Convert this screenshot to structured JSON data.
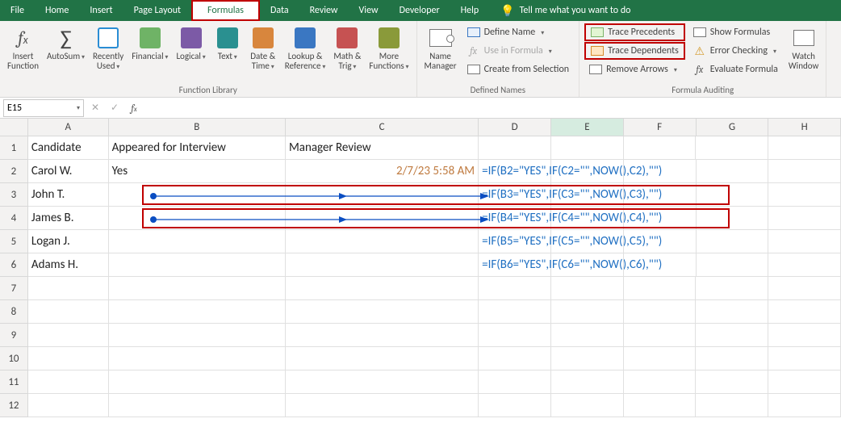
{
  "tabs": {
    "items": [
      "File",
      "Home",
      "Insert",
      "Page Layout",
      "Formulas",
      "Data",
      "Review",
      "View",
      "Developer",
      "Help"
    ],
    "active": "Formulas",
    "highlighted": "Formulas",
    "tell_me": "Tell me what you want to do"
  },
  "ribbon": {
    "groups": {
      "function_library": {
        "label": "Function Library",
        "insert_function": "Insert\nFunction",
        "autosum": "AutoSum",
        "recently_used": "Recently\nUsed",
        "financial": "Financial",
        "logical": "Logical",
        "text": "Text",
        "date_time": "Date &\nTime",
        "lookup_ref": "Lookup &\nReference",
        "math_trig": "Math &\nTrig",
        "more_functions": "More\nFunctions"
      },
      "defined_names": {
        "label": "Defined Names",
        "name_manager": "Name\nManager",
        "define_name": "Define Name",
        "use_in_formula": "Use in Formula",
        "create_from_selection": "Create from Selection"
      },
      "formula_auditing": {
        "label": "Formula Auditing",
        "trace_precedents": "Trace Precedents",
        "trace_dependents": "Trace Dependents",
        "remove_arrows": "Remove Arrows",
        "show_formulas": "Show Formulas",
        "error_checking": "Error Checking",
        "evaluate_formula": "Evaluate Formula",
        "watch_window": "Watch\nWindow"
      }
    }
  },
  "formula_bar": {
    "name_box": "E15",
    "formula": ""
  },
  "grid": {
    "columns": [
      "A",
      "B",
      "C",
      "D",
      "E",
      "F",
      "G",
      "H"
    ],
    "headers": {
      "A": "Candidate",
      "B": "Appeared for Interview",
      "C": "Manager Review"
    },
    "rows": [
      {
        "n": 2,
        "A": "Carol W.",
        "B": "Yes",
        "C": "2/7/23 5:58 AM",
        "D": "=IF(B2=\"YES\",IF(C2=\"\",NOW(),C2),\"\")"
      },
      {
        "n": 3,
        "A": "John T.",
        "B": "",
        "C": "",
        "D": "=IF(B3=\"YES\",IF(C3=\"\",NOW(),C3),\"\")"
      },
      {
        "n": 4,
        "A": "James B.",
        "B": "",
        "C": "",
        "D": "=IF(B4=\"YES\",IF(C4=\"\",NOW(),C4),\"\")"
      },
      {
        "n": 5,
        "A": "Logan J.",
        "B": "",
        "C": "",
        "D": "=IF(B5=\"YES\",IF(C5=\"\",NOW(),C5),\"\")"
      },
      {
        "n": 6,
        "A": "Adams H.",
        "B": "",
        "C": "",
        "D": "=IF(B6=\"YES\",IF(C6=\"\",NOW(),C6),\"\")"
      }
    ],
    "selected_cell": "E15",
    "selected_col": "E"
  },
  "colors": {
    "accent": "#217346",
    "highlight": "#c00000",
    "formula": "#1f6fc2",
    "timestamp": "#bf7a3f"
  }
}
